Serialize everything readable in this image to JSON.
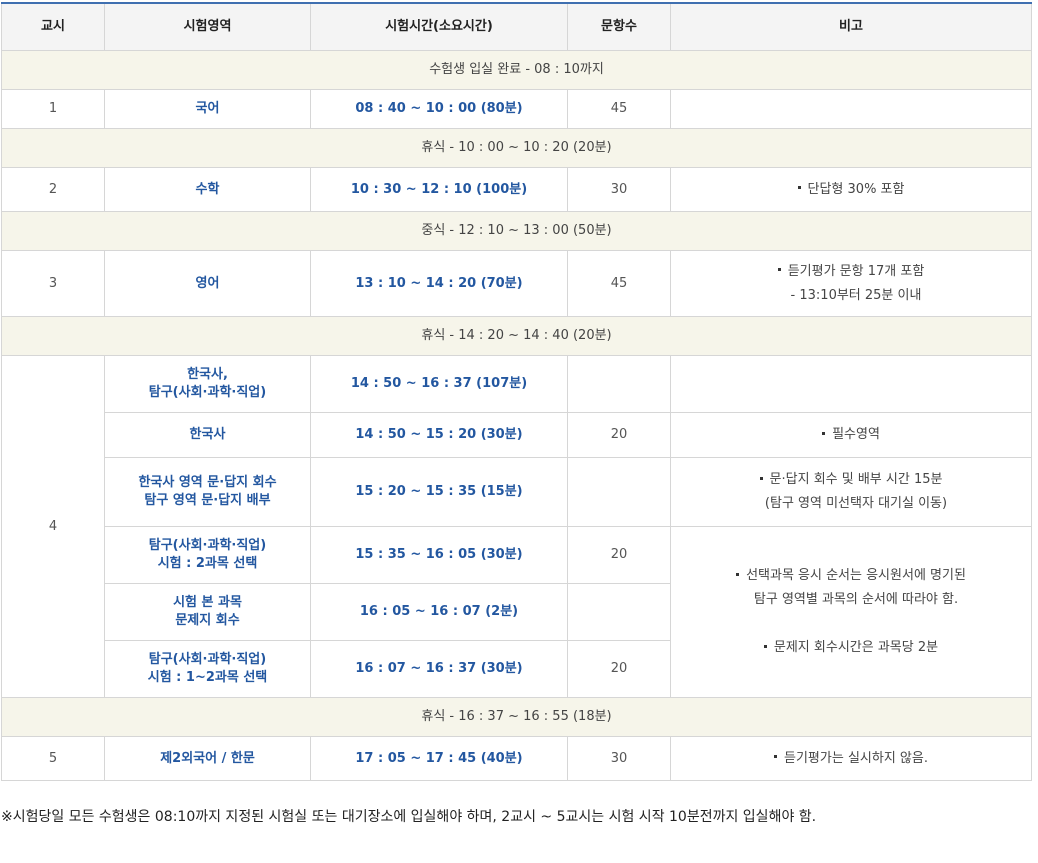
{
  "header": {
    "period": "교시",
    "area": "시험영역",
    "time": "시험시간(소요시간)",
    "count": "문항수",
    "note": "비고"
  },
  "breaks": {
    "b0": "수험생 입실 완료 - 08 : 10까지",
    "b1": "휴식 - 10 : 00 ~ 10 : 20 (20분)",
    "b2": "중식 - 12 : 10 ~ 13 : 00 (50분)",
    "b3": "휴식 - 14 : 20 ~ 14 : 40 (20분)",
    "b4": "휴식 - 16 : 37 ~ 16 : 55 (18분)"
  },
  "rows": {
    "p1": {
      "period": "1",
      "area": "국어",
      "time": "08 : 40 ~ 10 : 00 (80분)",
      "count": "45"
    },
    "p2": {
      "period": "2",
      "area": "수학",
      "time": "10 : 30 ~ 12 : 10 (100분)",
      "count": "30",
      "note": "단답형 30% 포함"
    },
    "p3": {
      "period": "3",
      "area": "영어",
      "time": "13 : 10 ~ 14 : 20 (70분)",
      "count": "45",
      "note1": "듣기평가 문항 17개 포함",
      "note2": "- 13:10부터 25분 이내"
    },
    "p4": {
      "period": "4",
      "a": {
        "area1": "한국사,",
        "area2": "탐구(사회·과학·직업)",
        "time": "14 : 50 ~ 16 : 37 (107분)"
      },
      "b": {
        "area": "한국사",
        "time": "14 : 50 ~ 15 : 20 (30분)",
        "count": "20",
        "note": "필수영역"
      },
      "c": {
        "area1": "한국사 영역 문·답지 회수",
        "area2": "탐구 영역 문·답지 배부",
        "time": "15 : 20 ~ 15 : 35 (15분)",
        "note1": "문·답지 회수 및 배부 시간 15분",
        "note2": "(탐구 영역 미선택자 대기실 이동)"
      },
      "d": {
        "area1": "탐구(사회·과학·직업)",
        "area2": "시험 : 2과목 선택",
        "time": "15 : 35 ~ 16 : 05 (30분)",
        "count": "20"
      },
      "e": {
        "area1": "시험 본 과목",
        "area2": "문제지 회수",
        "time": "16 : 05 ~ 16 : 07 (2분)"
      },
      "f": {
        "area1": "탐구(사회·과학·직업)",
        "area2": "시험 : 1~2과목 선택",
        "time": "16 : 07 ~ 16 : 37 (30분)",
        "count": "20"
      },
      "note_def1": "선택과목 응시 순서는 응시원서에 명기된",
      "note_def2": "탐구 영역별 과목의 순서에 따라야 함.",
      "note_def3": "문제지 회수시간은 과목당 2분"
    },
    "p5": {
      "period": "5",
      "area": "제2외국어 / 한문",
      "time": "17 : 05 ~ 17 : 45 (40분)",
      "count": "30",
      "note": "듣기평가는 실시하지 않음."
    }
  },
  "footnote": "※시험당일 모든 수험생은 08:10까지 지정된 시험실 또는 대기장소에 입실해야 하며, 2교시 ~ 5교시는 시험 시작 10분전까지 입실해야 함."
}
